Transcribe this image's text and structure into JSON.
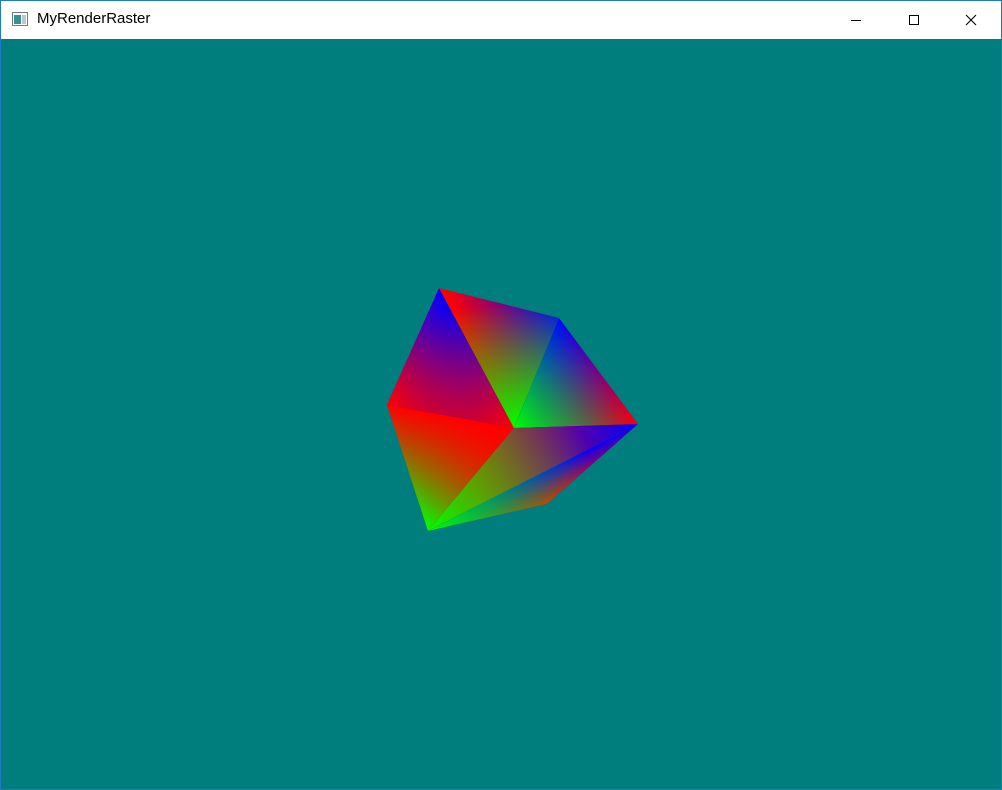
{
  "window": {
    "title": "MyRenderRaster",
    "controls": {
      "minimize": "minimize",
      "maximize": "maximize",
      "close": "close"
    }
  },
  "canvas": {
    "background_color": "#007e7e",
    "vertex_colors": {
      "red": "#ff0000",
      "green": "#00ff00",
      "blue": "#0000ff"
    }
  },
  "icons": {
    "app": "window-app-icon",
    "minimize": "minimize-icon",
    "maximize": "maximize-icon",
    "close": "close-icon"
  }
}
